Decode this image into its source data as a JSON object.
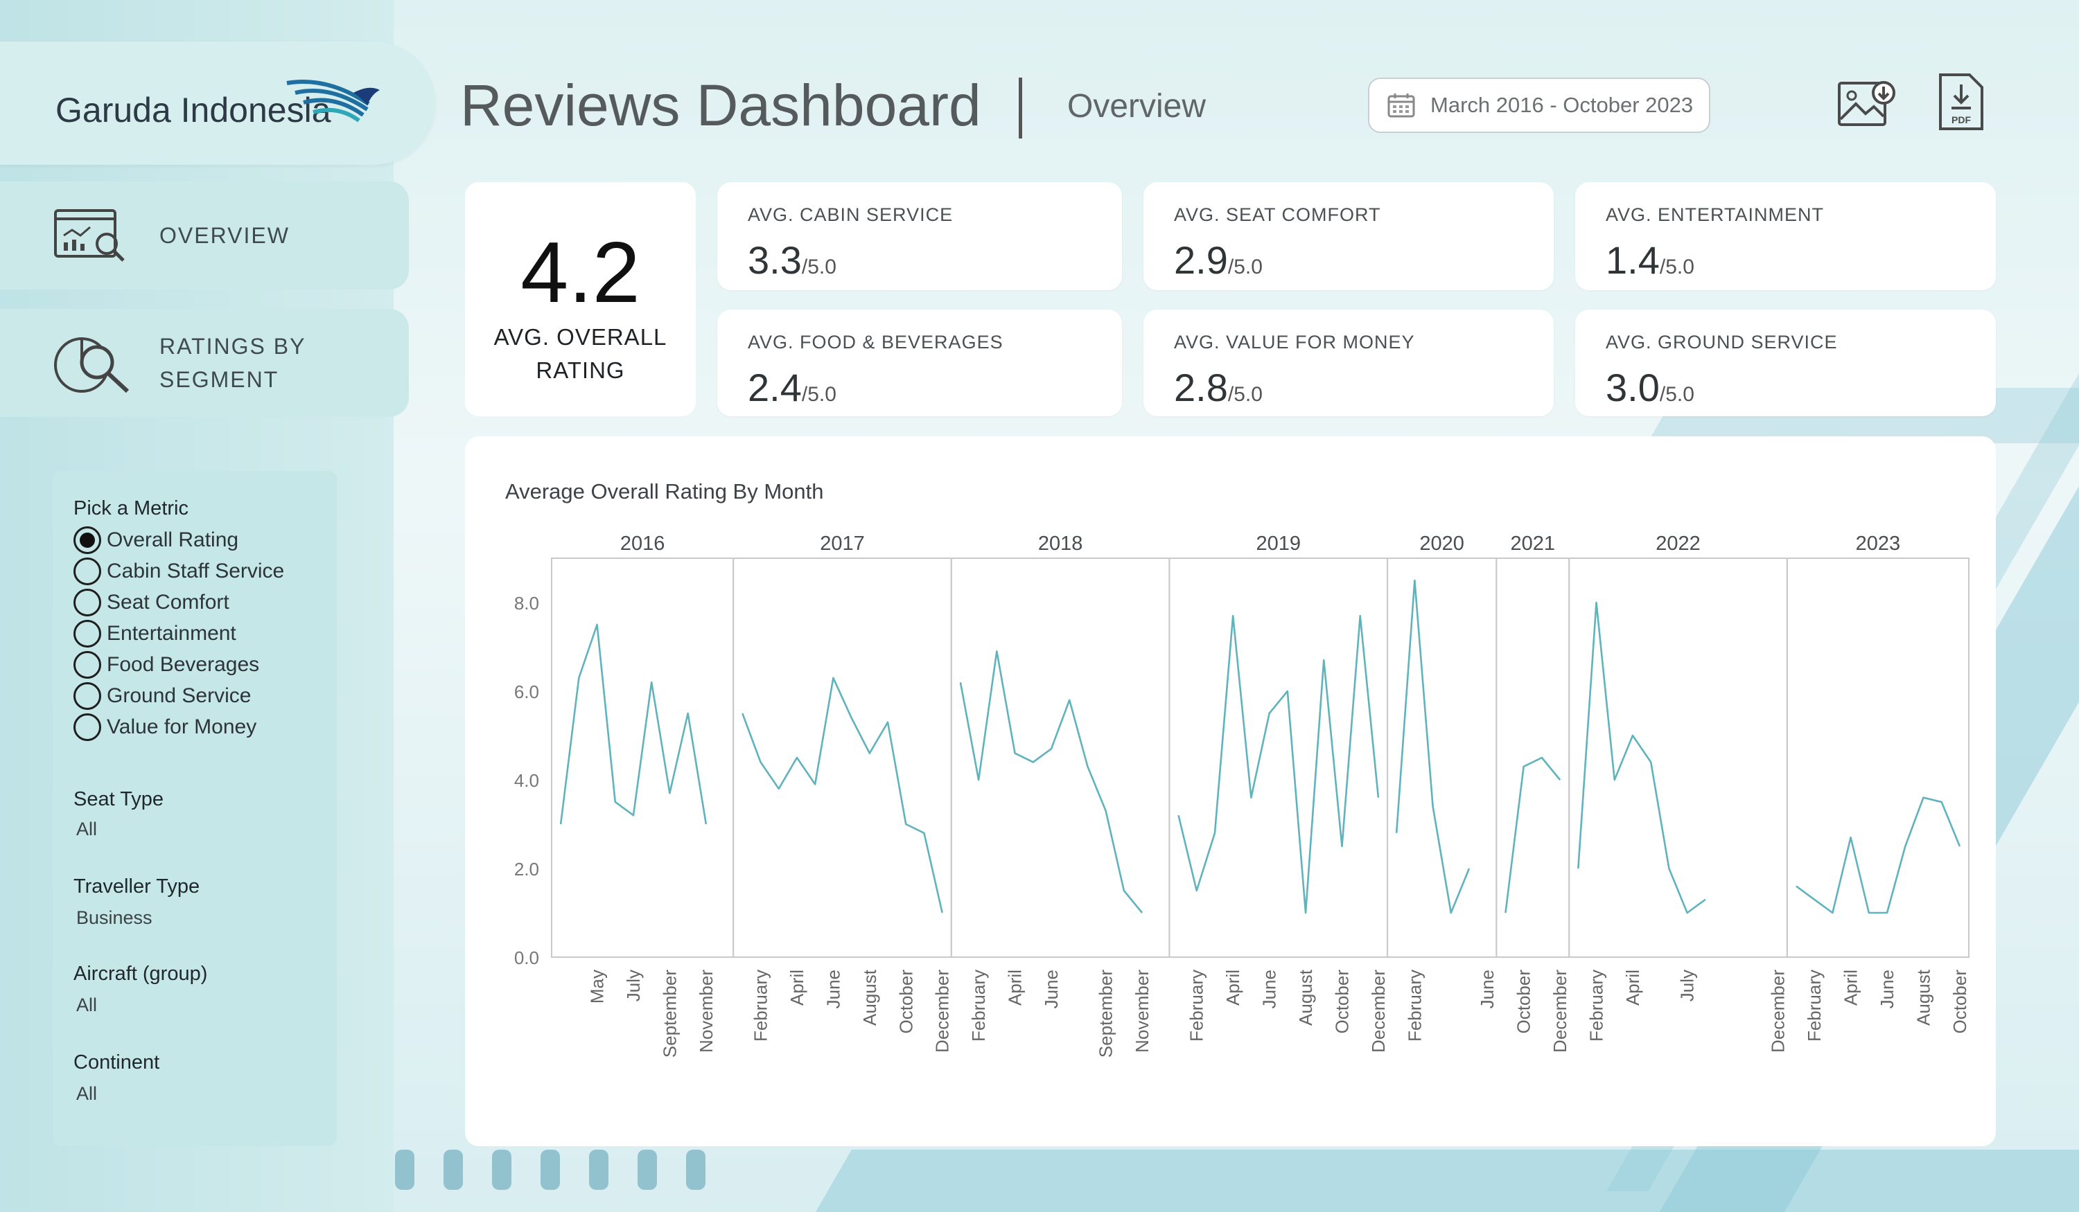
{
  "brand": {
    "name": "Garuda Indonesia",
    "logo_icon": "garuda-bird-logo"
  },
  "nav": [
    {
      "label": "OVERVIEW",
      "icon": "overview-chart-icon"
    },
    {
      "label_line1": "RATINGS BY",
      "label_line2": "SEGMENT",
      "icon": "ratings-search-icon"
    }
  ],
  "filters": {
    "metric_title": "Pick a Metric",
    "metrics": [
      "Overall Rating",
      "Cabin Staff Service",
      "Seat Comfort",
      "Entertainment",
      "Food Beverages",
      "Ground Service",
      "Value for Money"
    ],
    "selected_metric": "Overall Rating",
    "seat_type": {
      "label": "Seat Type",
      "value": "All"
    },
    "traveller_type": {
      "label": "Traveller Type",
      "value": "Business"
    },
    "aircraft": {
      "label": "Aircraft (group)",
      "value": "All"
    },
    "continent": {
      "label": "Continent",
      "value": "All"
    }
  },
  "header": {
    "title": "Reviews Dashboard",
    "separator": "|",
    "subtitle": "Overview",
    "date_range": "March 2016 - October 2023",
    "icons": [
      "calendar-icon",
      "image-download-icon",
      "pdf-download-icon"
    ]
  },
  "kpis": {
    "overall": {
      "value": "4.2",
      "label_line1": "AVG. OVERALL",
      "label_line2": "RATING"
    },
    "cards": [
      {
        "title": "AVG. CABIN SERVICE",
        "value": "3.3",
        "suffix": "/5.0"
      },
      {
        "title": "AVG. SEAT COMFORT",
        "value": "2.9",
        "suffix": "/5.0"
      },
      {
        "title": "AVG. ENTERTAINMENT",
        "value": "1.4",
        "suffix": "/5.0"
      },
      {
        "title": "AVG. FOOD & BEVERAGES",
        "value": "2.4",
        "suffix": "/5.0"
      },
      {
        "title": "AVG. VALUE FOR MONEY",
        "value": "2.8",
        "suffix": "/5.0"
      },
      {
        "title": "AVG. GROUND SERVICE",
        "value": "3.0",
        "suffix": "/5.0"
      }
    ]
  },
  "chart_data": {
    "type": "line",
    "title": "Average Overall Rating By Month",
    "xlabel": "",
    "ylabel": "",
    "ylim": [
      0,
      9
    ],
    "y_ticks": [
      "0.0",
      "2.0",
      "4.0",
      "6.0",
      "8.0"
    ],
    "color": "#5fb3bd",
    "grid": false,
    "panels": [
      {
        "year": "2016",
        "months": [
          "March",
          "April",
          "May",
          "June",
          "July",
          "August",
          "September",
          "October",
          "November",
          "December"
        ],
        "values": [
          3.0,
          6.3,
          7.5,
          3.5,
          3.2,
          6.2,
          3.7,
          5.5,
          3.0
        ],
        "month_labels": [
          "May",
          "July",
          "September",
          "November"
        ]
      },
      {
        "year": "2017",
        "months": [
          "January",
          "February",
          "March",
          "April",
          "May",
          "June",
          "July",
          "August",
          "September",
          "October",
          "November",
          "December"
        ],
        "values": [
          5.5,
          4.4,
          3.8,
          4.5,
          3.9,
          6.3,
          5.4,
          4.6,
          5.3,
          3.0,
          2.8,
          1.0
        ],
        "month_labels": [
          "February",
          "April",
          "June",
          "August",
          "October",
          "December"
        ]
      },
      {
        "year": "2018",
        "months": [
          "January",
          "February",
          "March",
          "April",
          "May",
          "June",
          "July",
          "August",
          "September",
          "October",
          "November",
          "December"
        ],
        "values": [
          6.2,
          4.0,
          6.9,
          4.6,
          4.4,
          4.7,
          5.8,
          4.3,
          3.3,
          1.5,
          1.0
        ],
        "month_labels": [
          "February",
          "April",
          "June",
          "September",
          "November"
        ]
      },
      {
        "year": "2019",
        "months": [
          "January",
          "February",
          "March",
          "April",
          "May",
          "June",
          "July",
          "August",
          "September",
          "October",
          "November",
          "December"
        ],
        "values": [
          3.2,
          1.5,
          2.8,
          7.7,
          3.6,
          5.5,
          6.0,
          1.0,
          6.7,
          2.5,
          7.7,
          3.6
        ],
        "month_labels": [
          "February",
          "April",
          "June",
          "August",
          "October",
          "December"
        ]
      },
      {
        "year": "2020",
        "months": [
          "January",
          "February",
          "March",
          "April",
          "May",
          "June"
        ],
        "values": [
          2.8,
          8.5,
          3.4,
          1.0,
          2.0
        ],
        "month_labels": [
          "February",
          "June"
        ]
      },
      {
        "year": "2021",
        "months": [
          "September",
          "October",
          "November",
          "December"
        ],
        "values": [
          1.0,
          4.3,
          4.5,
          4.0
        ],
        "month_labels": [
          "October",
          "December"
        ]
      },
      {
        "year": "2022",
        "months": [
          "January",
          "February",
          "March",
          "April",
          "May",
          "June",
          "July",
          "August",
          "September",
          "October",
          "November",
          "December"
        ],
        "values": [
          2.0,
          8.0,
          4.0,
          5.0,
          4.4,
          2.0,
          1.0,
          1.3
        ],
        "month_labels": [
          "February",
          "April",
          "July",
          "December"
        ]
      },
      {
        "year": "2023",
        "months": [
          "January",
          "February",
          "March",
          "April",
          "May",
          "June",
          "July",
          "August",
          "September",
          "October"
        ],
        "values": [
          1.6,
          1.3,
          1.0,
          2.7,
          1.0,
          1.0,
          2.5,
          3.6,
          3.5,
          2.5
        ],
        "month_labels": [
          "February",
          "April",
          "June",
          "August",
          "October"
        ]
      }
    ]
  }
}
